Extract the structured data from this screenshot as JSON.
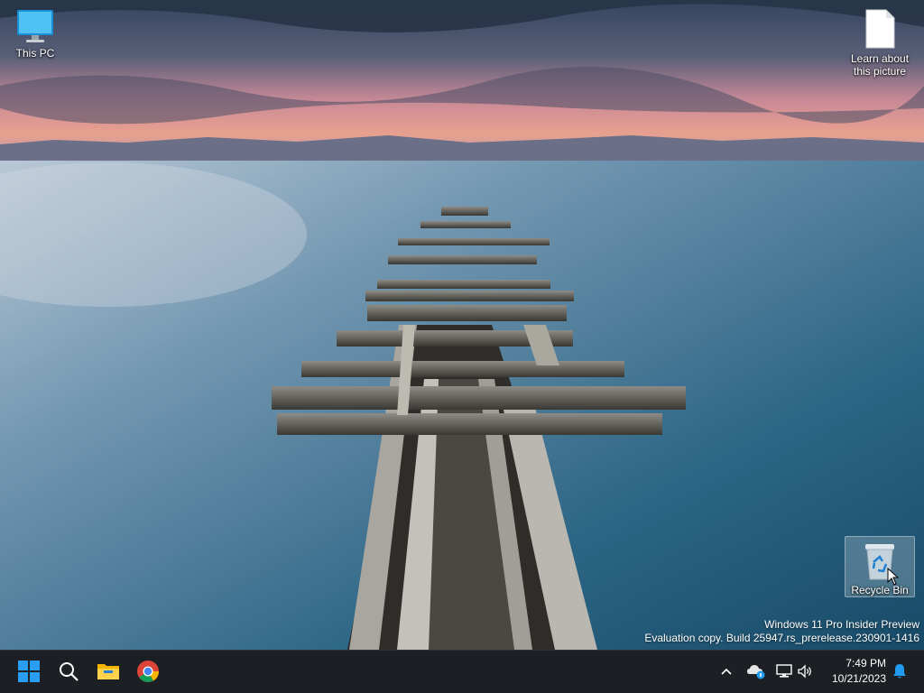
{
  "desktop": {
    "icons": [
      {
        "label": "This PC",
        "icon": "monitor-icon"
      },
      {
        "label": "Learn about this picture",
        "icon": "document-icon"
      },
      {
        "label": "Recycle Bin",
        "icon": "recycle-bin-icon"
      }
    ],
    "watermark": {
      "line1": "Windows 11 Pro Insider Preview",
      "line2": "Evaluation copy. Build 25947.rs_prerelease.230901-1416"
    }
  },
  "taskbar": {
    "apps": [
      {
        "icon": "windows-start-icon"
      },
      {
        "icon": "search-icon"
      },
      {
        "icon": "file-explorer-icon"
      },
      {
        "icon": "chrome-icon"
      }
    ],
    "tray": {
      "icons": [
        "chevron-up-icon",
        "onedrive-icon",
        "network-icon",
        "volume-icon",
        "notification-bell-icon"
      ],
      "time": "7:49 PM",
      "date": "10/21/2023"
    }
  },
  "colors": {
    "taskbar_bg": "#1c2025",
    "accent": "#1f9bf0"
  }
}
